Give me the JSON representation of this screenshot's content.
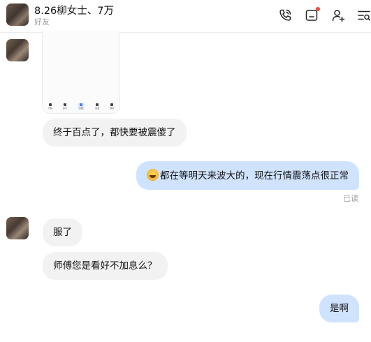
{
  "header": {
    "title": "8.26柳女士、7万",
    "subtitle": "好友",
    "icons": [
      "phone-call-icon",
      "inbox-icon",
      "add-friend-icon",
      "menu-icon"
    ],
    "notification_color": "#f24a3d"
  },
  "image_message": {
    "tabs": [
      "行情",
      "资讯",
      "交易",
      "自选",
      "我的"
    ]
  },
  "messages": [
    {
      "side": "left",
      "text": "终于百点了，都快要被震傻了"
    },
    {
      "side": "right",
      "emoji": "laughing-tears-emoji",
      "text": "都在等明天来波大的，现在行情震荡点很正常"
    },
    {
      "side": "left",
      "text": "服了"
    },
    {
      "side": "left",
      "text": "师傅您是看好不加息么？"
    },
    {
      "side": "right",
      "text": "是啊"
    }
  ],
  "read_status": "已读",
  "colors": {
    "right_bubble": "#cfe3ff",
    "left_bubble": "#f2f2f2"
  }
}
